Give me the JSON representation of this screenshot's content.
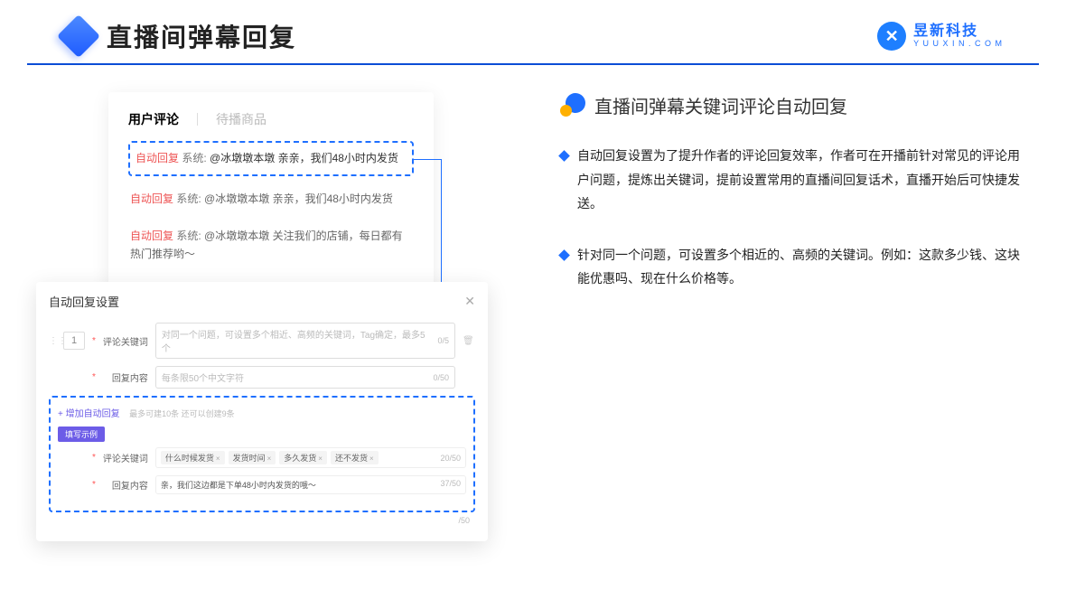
{
  "header": {
    "title": "直播间弹幕回复",
    "brand_name": "昱新科技",
    "brand_url": "Y U U X I N . C O M",
    "brand_glyph": "✕"
  },
  "comment_panel": {
    "tab_active": "用户评论",
    "tab_inactive": "待播商品",
    "rows": [
      {
        "tag": "自动回复",
        "sys": "系统:",
        "text": "@冰墩墩本墩 亲亲，我们48小时内发货"
      },
      {
        "tag": "自动回复",
        "sys": "系统:",
        "text": "@冰墩墩本墩 亲亲，我们48小时内发货"
      },
      {
        "tag": "自动回复",
        "sys": "系统:",
        "text": "@冰墩墩本墩 关注我们的店铺，每日都有热门推荐哟～"
      }
    ]
  },
  "settings": {
    "title": "自动回复设置",
    "close": "✕",
    "index": "1",
    "row1_label": "评论关键词",
    "row1_placeholder": "对同一个问题，可设置多个相近、高频的关键词，Tag确定，最多5个",
    "row1_count": "0/5",
    "row2_label": "回复内容",
    "row2_placeholder": "每条限50个中文字符",
    "row2_count": "0/50",
    "add_link": "+ 增加自动回复",
    "add_hint": "最多可建10条 还可以创建9条",
    "example_badge": "填写示例",
    "ex_row1_label": "评论关键词",
    "ex_tags": [
      "什么时候发货",
      "发货时间",
      "多久发货",
      "还不发货"
    ],
    "ex_row1_count": "20/50",
    "ex_row2_label": "回复内容",
    "ex_row2_text": "亲，我们这边都是下单48小时内发货的哦～",
    "ex_row2_count": "37/50",
    "trailing_count": "/50"
  },
  "right": {
    "section_title": "直播间弹幕关键词评论自动回复",
    "bullet1": "自动回复设置为了提升作者的评论回复效率，作者可在开播前针对常见的评论用户问题，提炼出关键词，提前设置常用的直播间回复话术，直播开始后可快捷发送。",
    "bullet2": "针对同一个问题，可设置多个相近的、高频的关键词。例如：这款多少钱、这块能优惠吗、现在什么价格等。"
  }
}
